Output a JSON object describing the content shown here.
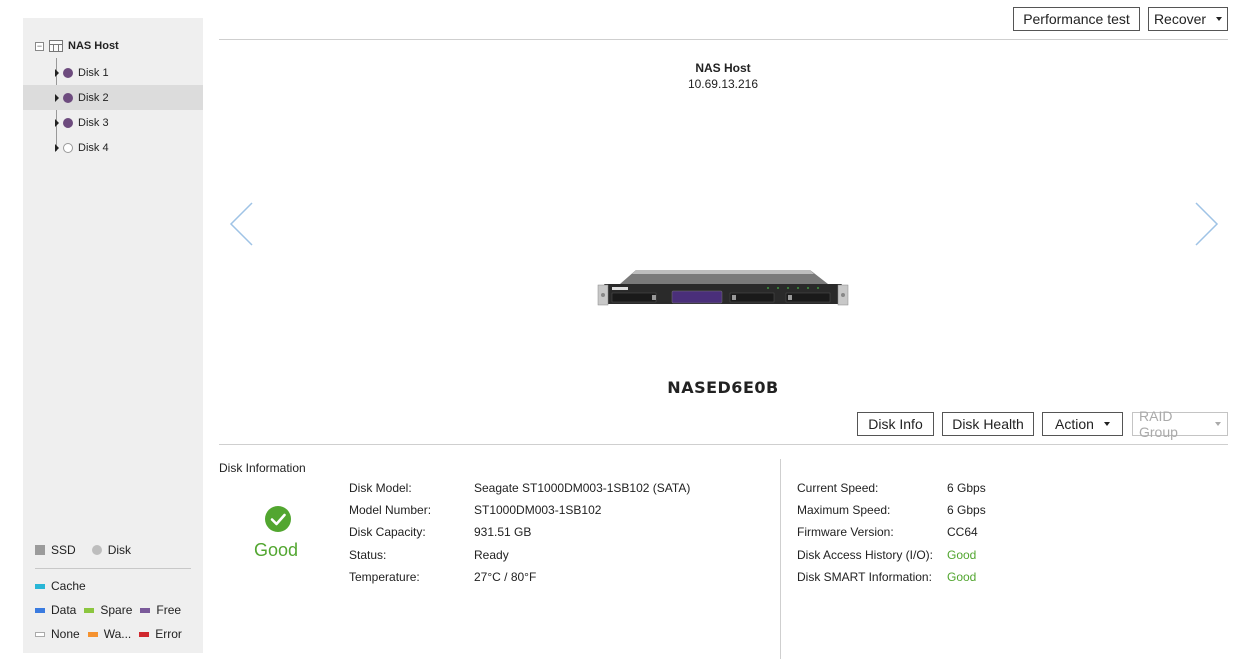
{
  "sidebar": {
    "root_label": "NAS Host",
    "disks": [
      {
        "label": "Disk 1",
        "type": "filled"
      },
      {
        "label": "Disk 2",
        "type": "filled",
        "selected": true
      },
      {
        "label": "Disk 3",
        "type": "filled"
      },
      {
        "label": "Disk 4",
        "type": "empty"
      }
    ],
    "legend": {
      "ssd": "SSD",
      "disk": "Disk",
      "cache": "Cache",
      "data": "Data",
      "spare": "Spare",
      "free": "Free",
      "none": "None",
      "warning": "Wa...",
      "error": "Error"
    }
  },
  "toolbar": {
    "performance_test": "Performance test",
    "recover": "Recover"
  },
  "device": {
    "host_title": "NAS Host",
    "ip": "10.69.13.216",
    "name": "NASED6E0B"
  },
  "actions": {
    "disk_info": "Disk Info",
    "disk_health": "Disk Health",
    "action": "Action",
    "raid_group": "RAID Group"
  },
  "disk_information": {
    "title": "Disk Information",
    "status_text": "Good",
    "left": [
      {
        "label": "Disk Model:",
        "value": "Seagate ST1000DM003-1SB102 (SATA)"
      },
      {
        "label": "Model Number:",
        "value": "ST1000DM003-1SB102"
      },
      {
        "label": "Disk Capacity:",
        "value": "931.51 GB"
      },
      {
        "label": "Status:",
        "value": "Ready"
      },
      {
        "label": "Temperature:",
        "value": "27°C / 80°F"
      }
    ],
    "right": [
      {
        "label": "Current Speed:",
        "value": "6 Gbps"
      },
      {
        "label": "Maximum Speed:",
        "value": "6 Gbps"
      },
      {
        "label": "Firmware Version:",
        "value": "CC64"
      },
      {
        "label": "Disk Access History (I/O):",
        "value": "Good"
      },
      {
        "label": "Disk SMART Information:",
        "value": "Good"
      }
    ]
  },
  "colors": {
    "good": "#52a630",
    "disk_dot": "#6d4b7e",
    "cache": "#29b6d6",
    "data": "#3a7be0",
    "spare": "#8cc63f",
    "free": "#7a5a9a",
    "warning": "#f5922f",
    "error": "#d0282e"
  }
}
